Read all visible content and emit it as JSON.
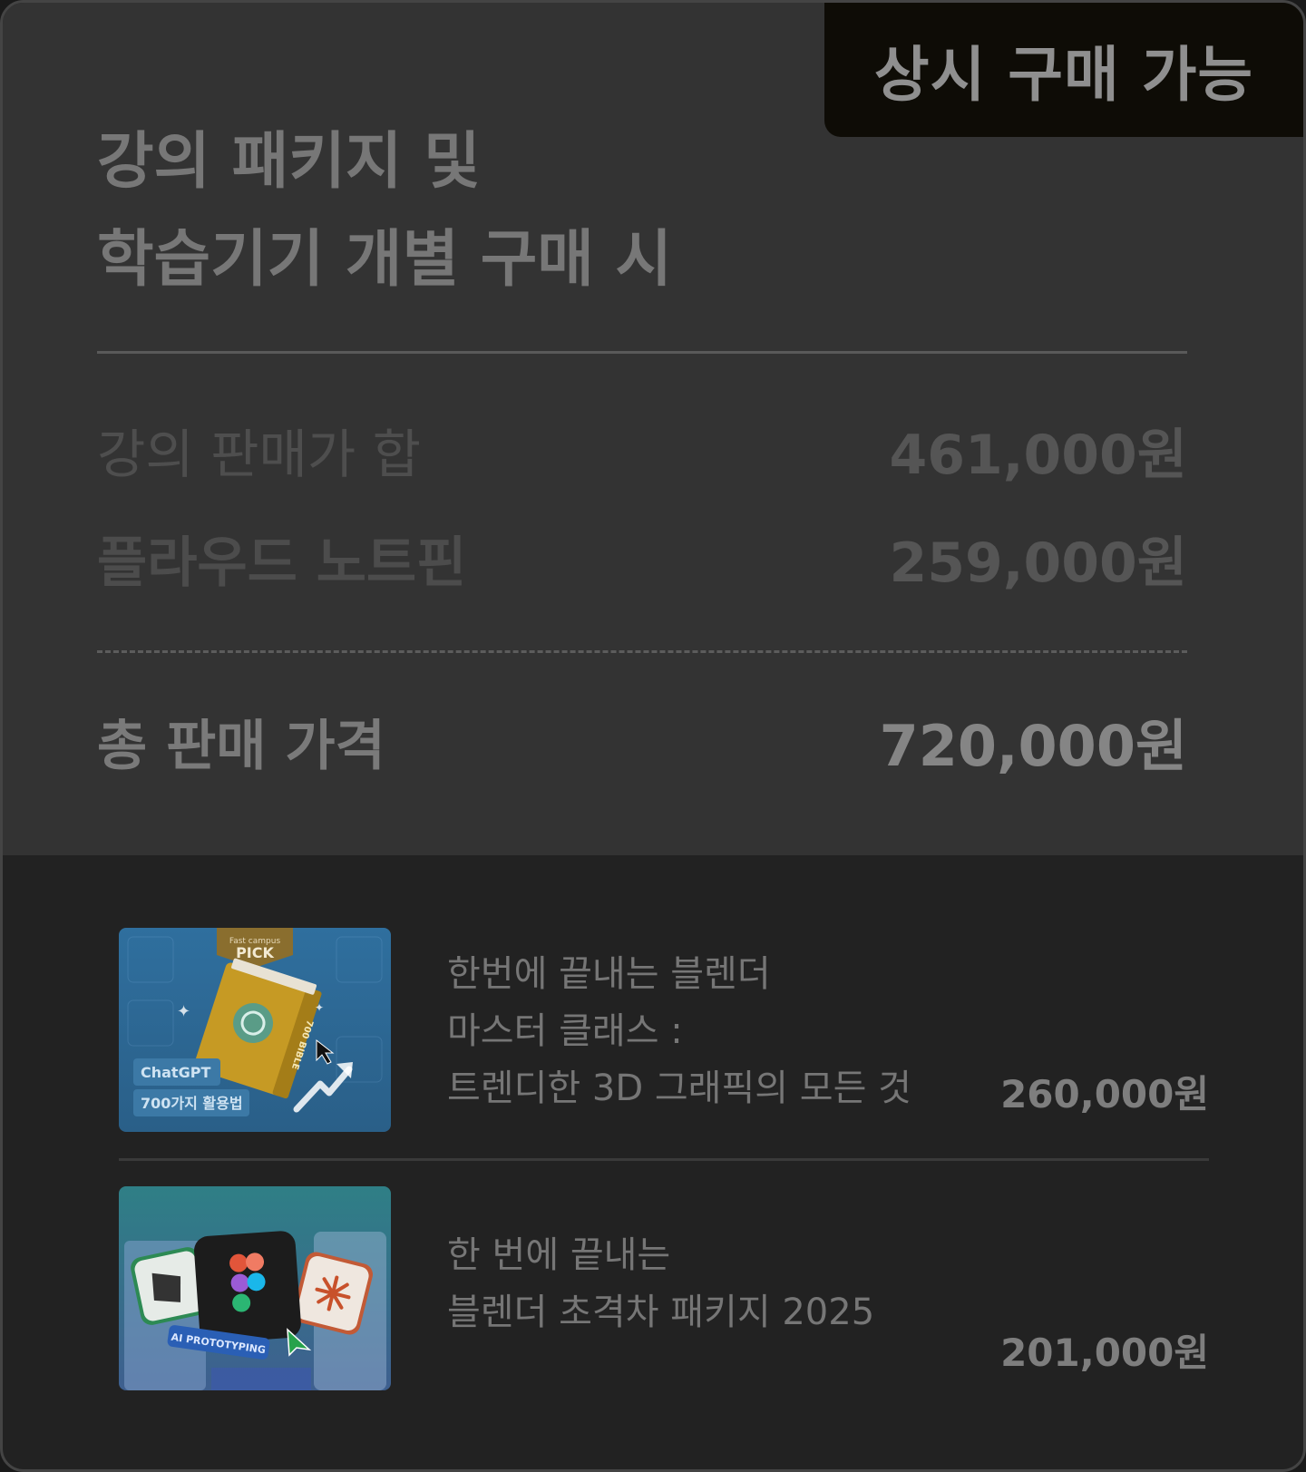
{
  "badge": "상시 구매 가능",
  "title": {
    "line1": "강의 패키지 및",
    "line2": "학습기기 개별 구매 시"
  },
  "summary": {
    "course_total_label": "강의 판매가 합",
    "course_total_value": "461,000원",
    "device_label": "플라우드 노트핀",
    "device_value": "259,000원",
    "grand_total_label": "총 판매 가격",
    "grand_total_value": "720,000원"
  },
  "items": [
    {
      "name_lines": [
        "한번에 끝내는 블렌더",
        "마스터 클래스 :",
        "트렌디한 3D 그래픽의 모든 것"
      ],
      "price": "260,000원",
      "thumb": {
        "badge_small": "Fast campus",
        "badge": "PICK",
        "tag1": "ChatGPT",
        "tag2": "700가지 활용법",
        "book_spine": "700 BIBLE"
      }
    },
    {
      "name_lines": [
        "한 번에 끝내는",
        "블렌더 초격차 패키지 2025"
      ],
      "price": "201,000원",
      "thumb": {
        "label": "AI PROTOTYPING"
      }
    }
  ],
  "colors": {
    "top_bg": "#333333",
    "bottom_bg": "#222222",
    "badge_bg": "#0e0c06"
  }
}
